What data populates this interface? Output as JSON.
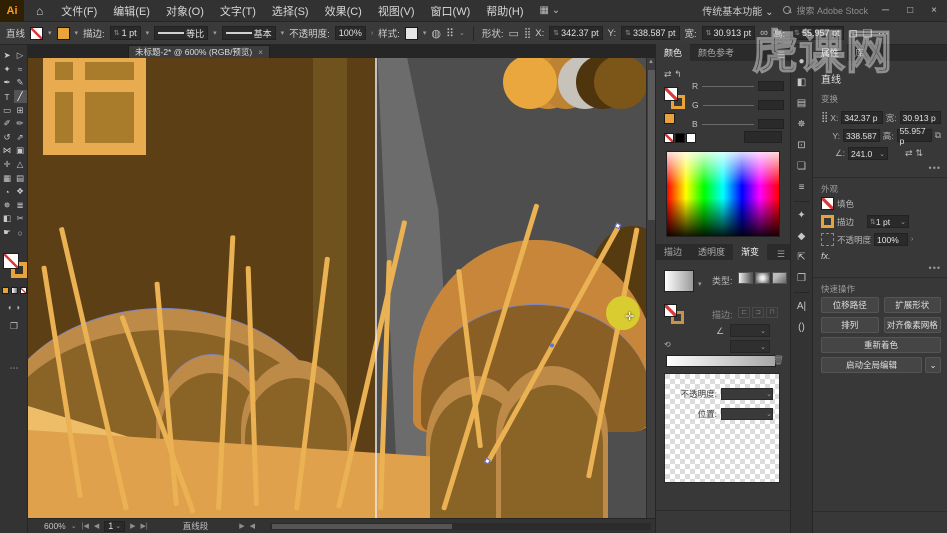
{
  "app": {
    "logo": "Ai",
    "home_icon": "⌂",
    "workspace": "传统基本功能",
    "search_label": "搜索 Adobe Stock",
    "window_min": "─",
    "window_max": "□",
    "window_close": "×"
  },
  "menu": {
    "items": [
      "文件(F)",
      "编辑(E)",
      "对象(O)",
      "文字(T)",
      "选择(S)",
      "效果(C)",
      "视图(V)",
      "窗口(W)",
      "帮助(H)"
    ]
  },
  "control_bar": {
    "tool_name": "直线",
    "stroke_label": "描边:",
    "stroke_width": "1 pt",
    "profile_label": "等比",
    "brush_label": "基本",
    "opacity_label": "不透明度:",
    "opacity_value": "100%",
    "style_label": "样式:",
    "shape_label": "形状:",
    "x_label": "X:",
    "x_value": "342.37 pt",
    "y_label": "Y:",
    "y_value": "338.587 pt",
    "w_label": "宽:",
    "w_value": "30.913 pt",
    "h_label": "高:",
    "h_value": "55.957 pt"
  },
  "document_tab": {
    "title": "未标题-2* @ 600% (RGB/预览)",
    "close_label": "×"
  },
  "tools": {
    "items": [
      {
        "n": "selection-tool",
        "g": "➤"
      },
      {
        "n": "direct-selection-tool",
        "g": "▷"
      },
      {
        "n": "magic-wand-tool",
        "g": "✦"
      },
      {
        "n": "lasso-tool",
        "g": "≈"
      },
      {
        "n": "pen-tool",
        "g": "✒"
      },
      {
        "n": "curvature-tool",
        "g": "✎"
      },
      {
        "n": "type-tool",
        "g": "T"
      },
      {
        "n": "line-segment-tool",
        "g": "╱",
        "active": true
      },
      {
        "n": "rectangle-tool",
        "g": "▭"
      },
      {
        "n": "shape-builder-tool",
        "g": "⊞"
      },
      {
        "n": "paintbrush-tool",
        "g": "✐"
      },
      {
        "n": "pencil-tool",
        "g": "✏"
      },
      {
        "n": "rotate-tool",
        "g": "↺"
      },
      {
        "n": "scale-tool",
        "g": "⇗"
      },
      {
        "n": "width-tool",
        "g": "⋈"
      },
      {
        "n": "free-transform-tool",
        "g": "▣"
      },
      {
        "n": "puppet-warp-tool",
        "g": "✛"
      },
      {
        "n": "perspective-grid-tool",
        "g": "△"
      },
      {
        "n": "mesh-tool",
        "g": "▦"
      },
      {
        "n": "gradient-tool",
        "g": "▤"
      },
      {
        "n": "eyedropper-tool",
        "g": "◔"
      },
      {
        "n": "blend-tool",
        "g": "❖"
      },
      {
        "n": "symbol-sprayer-tool",
        "g": "✵"
      },
      {
        "n": "column-graph-tool",
        "g": "≣"
      },
      {
        "n": "artboard-tool",
        "g": "◧"
      },
      {
        "n": "slice-tool",
        "g": "✂"
      },
      {
        "n": "hand-tool",
        "g": "☛"
      },
      {
        "n": "zoom-tool",
        "g": "○"
      }
    ],
    "more_label": "⋯"
  },
  "dock": {
    "icons": [
      {
        "n": "color-panel-icon",
        "g": "●"
      },
      {
        "n": "swatches-panel-icon",
        "g": "◧"
      },
      {
        "n": "brushes-panel-icon",
        "g": "▤"
      },
      {
        "n": "symbols-panel-icon",
        "g": "✵"
      },
      {
        "n": "transform-panel-icon",
        "g": "⊡"
      },
      {
        "n": "pathfinder-panel-icon",
        "g": "❏"
      },
      {
        "n": "align-panel-icon",
        "g": "≡"
      },
      {
        "n": "graphic-styles-panel-icon",
        "g": "✦"
      },
      {
        "n": "layers-panel-icon",
        "g": "◆"
      },
      {
        "n": "export-panel-icon",
        "g": "⇱"
      },
      {
        "n": "artboards-panel-icon",
        "g": "❐"
      },
      {
        "n": "character-panel-icon",
        "g": "A|"
      },
      {
        "n": "paragraph-panel-icon",
        "g": "()"
      }
    ]
  },
  "panels": {
    "color": {
      "tabs": [
        "颜色",
        "颜色参考"
      ],
      "r_label": "R",
      "g_label": "G",
      "b_label": "B"
    },
    "gradient": {
      "tabs": [
        "描边",
        "透明度",
        "渐变"
      ],
      "type_label": "类型:",
      "stroke_label": "描边:",
      "angle_label": "∠",
      "reverse_icon": "⟲",
      "stop_opacity_label": "不透明度:",
      "stop_location_label": "位置:"
    },
    "properties": {
      "tabs": [
        "属性",
        "库"
      ],
      "object_type": "直线",
      "transform": {
        "heading": "变换",
        "x_label": "X:",
        "x_value": "342.37 p",
        "w_label": "宽:",
        "w_value": "30.913 p",
        "y_label": "Y:",
        "y_value": "338.587",
        "h_label": "高:",
        "h_value": "55.957 p",
        "angle_label": "∠:",
        "angle_value": "241.0"
      },
      "appearance": {
        "heading": "外观",
        "fill_label": "填色",
        "stroke_label": "描边",
        "stroke_width": "1 pt",
        "opacity_label": "不透明度",
        "opacity_value": "100%",
        "fx_label": "fx."
      },
      "quick_actions": {
        "heading": "快速操作",
        "buttons": [
          {
            "name": "offset-path-button",
            "label": "位移路径"
          },
          {
            "name": "expand-shape-button",
            "label": "扩展形状"
          },
          {
            "name": "arrange-button",
            "label": "排列"
          },
          {
            "name": "align-pixel-grid-button",
            "label": "对齐像素网格"
          },
          {
            "name": "recolor-button",
            "label": "重新着色"
          },
          {
            "name": "global-edit-button",
            "label": "启动全局编辑"
          }
        ]
      }
    }
  },
  "status_bar": {
    "zoom": "600%",
    "artboard_number": "1",
    "tool_name": "直线段"
  },
  "watermark": {
    "text": "虎课网"
  },
  "artwork": {
    "colors": {
      "pasteboard": "#4e4e4e",
      "wedge": "#6c6c6c",
      "artboard_bg": "#5d3f15",
      "strip": "#6f521d",
      "window_frame": "#e9ab50",
      "window_pane": "#a87c2b",
      "mound_light": "#be8a47",
      "mound_dark": "#8a6426",
      "mound_right_light": "#c8863b",
      "mound_right_dark": "#8a5f26",
      "mound_far_dark": "#563a10",
      "ground": "#dfa14c",
      "ground_light": "#edbe67",
      "stick": "#ebb254",
      "yellow_dot": "#d9cc30",
      "selection_blue": "#7e86c8"
    },
    "palette_circles": [
      "#E9A73E",
      "#CA8B34",
      "#BE8233",
      "#C7C3BA",
      "#4E350E",
      "#7C5519"
    ],
    "sticks": [
      [
        52,
        440,
        235,
        -9
      ],
      [
        98,
        452,
        290,
        -13
      ],
      [
        148,
        448,
        225,
        -5
      ],
      [
        165,
        455,
        210,
        -20
      ],
      [
        190,
        452,
        275,
        3
      ],
      [
        228,
        448,
        240,
        -2
      ],
      [
        268,
        452,
        255,
        7
      ],
      [
        310,
        450,
        295,
        13
      ],
      [
        352,
        452,
        250,
        2
      ],
      [
        415,
        452,
        320,
        17
      ],
      [
        452,
        390,
        180,
        -7
      ],
      [
        560,
        420,
        255,
        11
      ]
    ],
    "selected_stick": [
      460,
      403,
      268,
      29
    ]
  }
}
